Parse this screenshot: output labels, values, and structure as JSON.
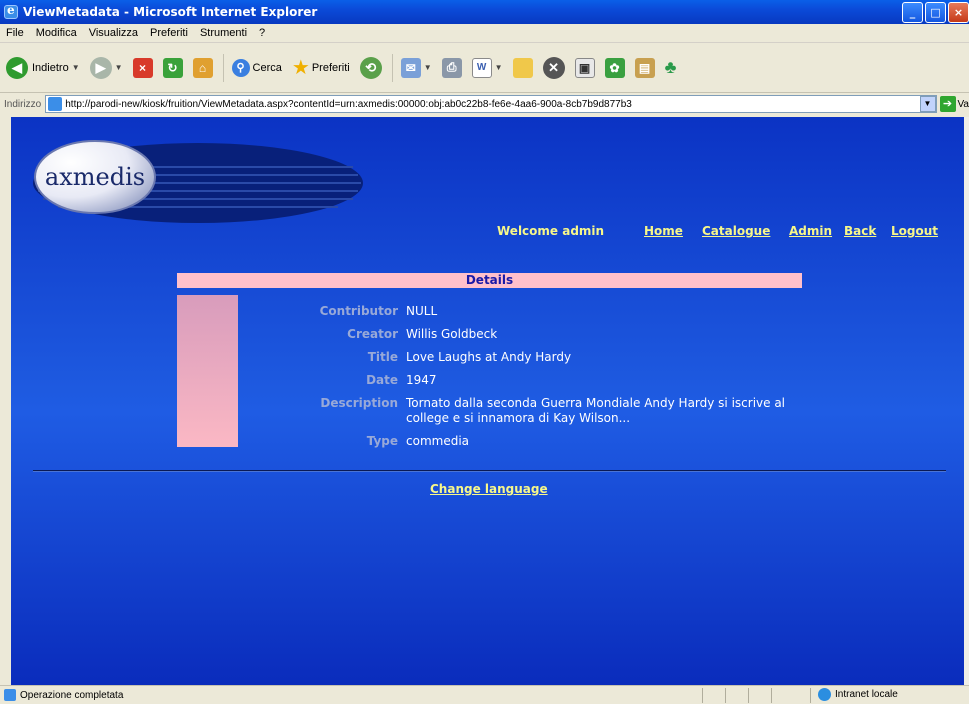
{
  "window": {
    "title": "ViewMetadata - Microsoft Internet Explorer",
    "controls": {
      "minimize": "_",
      "maximize": "□",
      "close": "×"
    }
  },
  "menu": [
    "File",
    "Modifica",
    "Visualizza",
    "Preferiti",
    "Strumenti",
    "?"
  ],
  "toolbar": {
    "back_label": "Indietro",
    "search_label": "Cerca",
    "favorites_label": "Preferiti"
  },
  "address": {
    "label": "Indirizzo",
    "url": "http://parodi-new/kiosk/fruition/ViewMetadata.aspx?contentId=urn:axmedis:00000:obj:ab0c22b8-fe6e-4aa6-900a-8cb7b9d877b3",
    "go_label": "Va"
  },
  "page": {
    "logo_text": "axmedis",
    "nav": {
      "welcome": "Welcome admin",
      "home": "Home",
      "catalogue": "Catalogue",
      "admin": "Admin",
      "back": "Back",
      "logout": "Logout"
    },
    "details_header": "Details",
    "fields": [
      {
        "label": "Contributor",
        "value": "NULL"
      },
      {
        "label": "Creator",
        "value": "Willis Goldbeck"
      },
      {
        "label": "Title",
        "value": "Love Laughs at Andy Hardy"
      },
      {
        "label": "Date",
        "value": "1947"
      },
      {
        "label": "Description",
        "value": "Tornato dalla seconda Guerra Mondiale Andy Hardy si iscrive al",
        "value2": "college e si innamora di Kay Wilson..."
      },
      {
        "label": "Type",
        "value": "commedia"
      }
    ],
    "change_language": "Change language"
  },
  "status": {
    "text": "Operazione completata",
    "zone": "Intranet locale"
  },
  "colors": {
    "page_blue": "#1e5ae0",
    "link_yellow": "#f7f78a",
    "details_pink": "#ffc0cb",
    "label_gray_blue": "#98a9d8"
  }
}
